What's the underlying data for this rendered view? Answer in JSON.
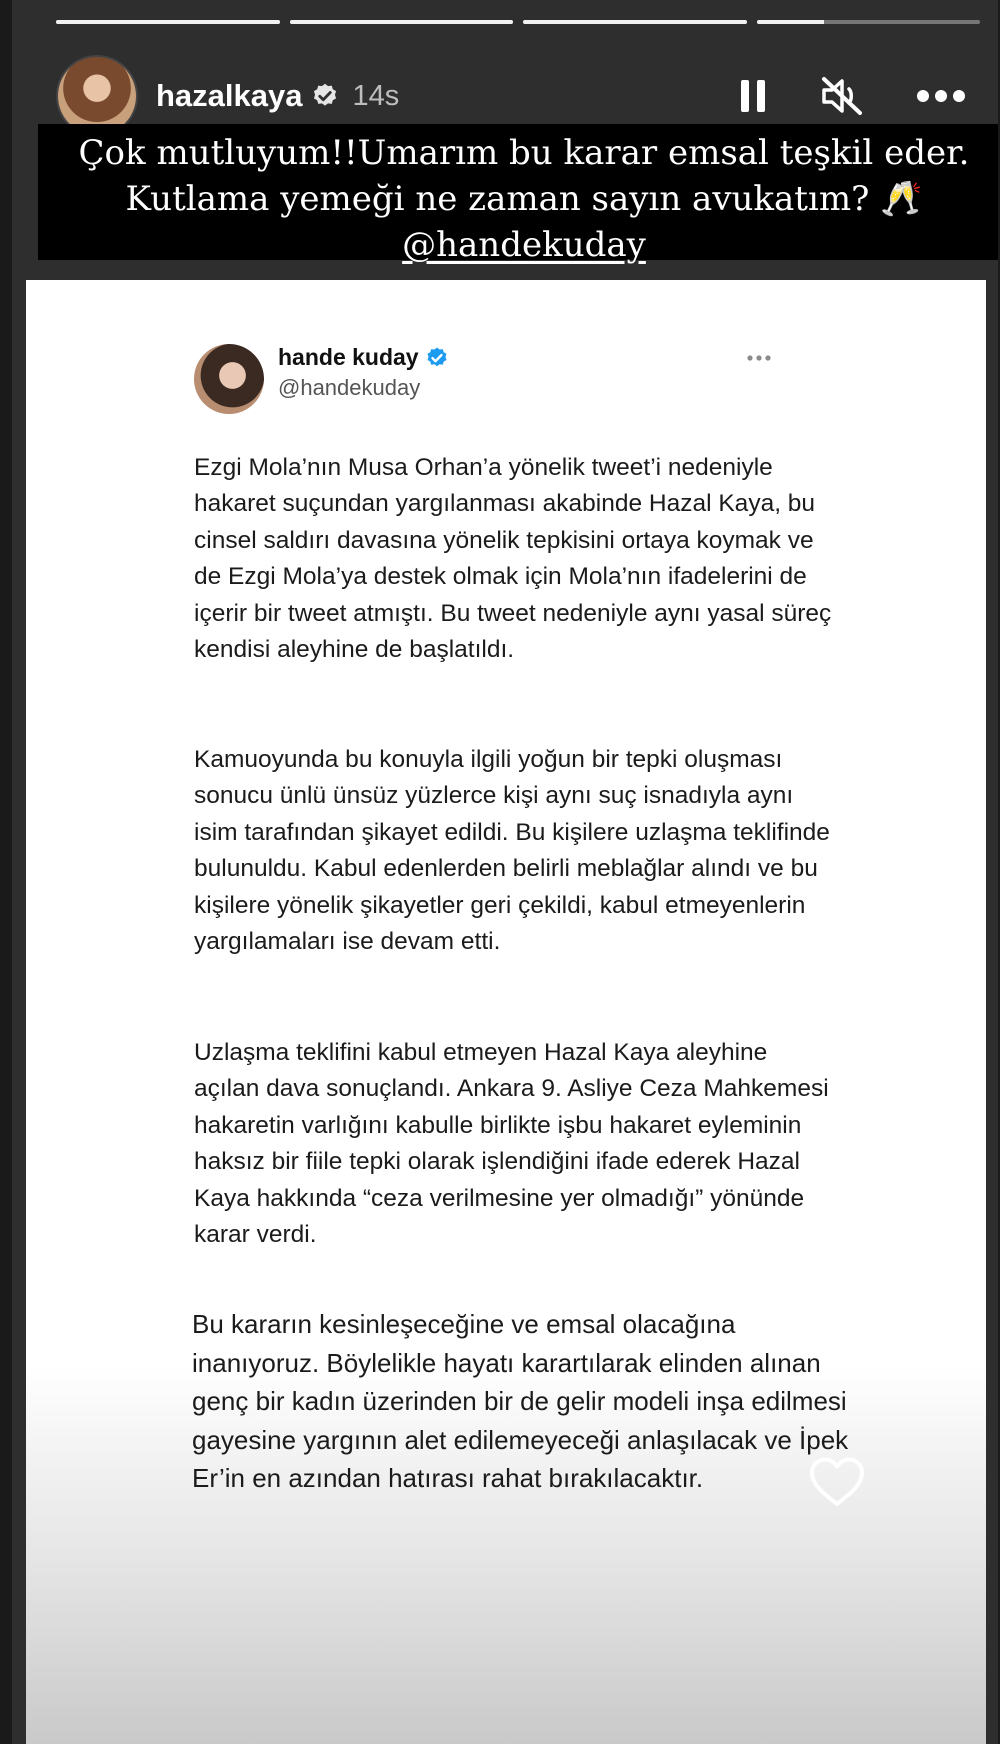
{
  "story": {
    "progress": [
      1,
      1,
      1,
      0.3
    ],
    "username": "hazalkaya",
    "time": "14s",
    "caption_lines": [
      "Çok mutluyum!!Umarım bu karar emsal teşkil eder.",
      "Kutlama yemeği ne zaman sayın avukatım? 🥂"
    ],
    "caption_mention": "@handekuday"
  },
  "tweet": {
    "name": "hande kuday",
    "handle": "@handekuday",
    "paragraphs": [
      "Ezgi Mola’nın Musa Orhan’a yönelik tweet’i nedeniyle hakaret suçundan yargılanması akabinde Hazal Kaya, bu cinsel saldırı davasına yönelik tepkisini ortaya koymak ve de Ezgi Mola’ya destek olmak için Mola’nın ifadelerini de içerir bir tweet atmıştı. Bu tweet nedeniyle aynı yasal süreç kendisi aleyhine de başlatıldı.",
      "Kamuoyunda bu konuyla ilgili yoğun bir tepki oluşması sonucu ünlü ünsüz yüzlerce kişi aynı suç isnadıyla aynı isim tarafından şikayet edildi. Bu kişilere uzlaşma teklifinde bulunuldu. Kabul edenlerden belirli meblağlar alındı ve bu kişilere yönelik şikayetler geri çekildi, kabul etmeyenlerin yargılamaları ise devam etti.",
      "Uzlaşma teklifini kabul etmeyen Hazal Kaya aleyhine açılan dava sonuçlandı. Ankara 9. Asliye Ceza Mahkemesi hakaretin varlığını kabulle birlikte işbu hakaret eyleminin haksız bir fiile tepki olarak işlendiğini ifade ederek Hazal Kaya hakkında “ceza verilmesine yer olmadığı” yönünde karar verdi.",
      "Bu kararın kesinleşeceğine ve emsal olacağına inanıyoruz. Böylelikle hayatı karartılarak elinden alınan genç bir kadın üzerinden bir de gelir modeli inşa edilmesi gayesine yargının alet edilemeyeceği anlaşılacak ve İpek Er’in en azından hatırası rahat bırakılacaktır."
    ]
  },
  "icons": {
    "pause": "pause-icon",
    "mute": "muted-speaker-icon",
    "more": "more-options-icon",
    "like": "heart-icon",
    "verified": "verified-badge-icon"
  },
  "colors": {
    "verified_instagram": "#ffffff",
    "verified_twitter": "#1d9bf0"
  }
}
